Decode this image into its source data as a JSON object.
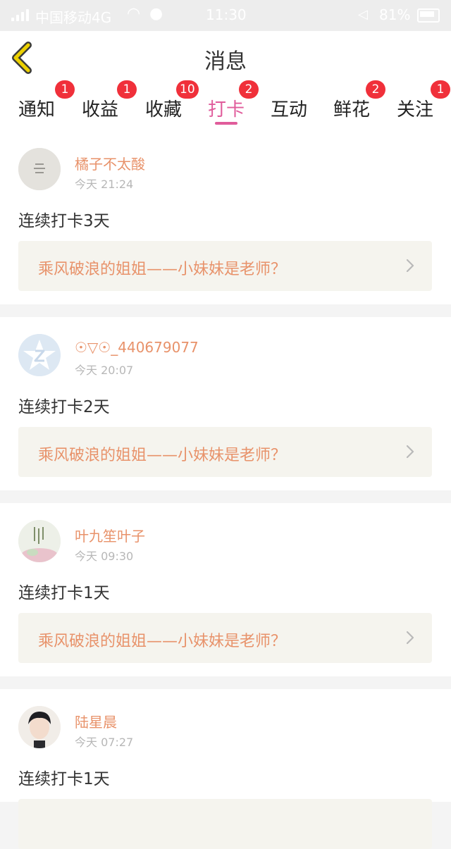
{
  "status_bar": {
    "carrier": "中国移动4G",
    "time": "11:30",
    "battery": "81%"
  },
  "header": {
    "title": "消息"
  },
  "tabs": [
    {
      "label": "通知",
      "badge": "1",
      "active": false
    },
    {
      "label": "收益",
      "badge": "1",
      "active": false
    },
    {
      "label": "收藏",
      "badge": "10",
      "active": false
    },
    {
      "label": "打卡",
      "badge": "2",
      "active": true
    },
    {
      "label": "互动",
      "badge": "",
      "active": false
    },
    {
      "label": "鲜花",
      "badge": "2",
      "active": false
    },
    {
      "label": "关注",
      "badge": "1",
      "active": false
    }
  ],
  "feed": [
    {
      "username": "橘子不太酸",
      "time": "今天 21:24",
      "message": "连续打卡3天",
      "topic": "乘风破浪的姐姐——小妹妹是老师？"
    },
    {
      "username": "☉▽☉_440679077",
      "time": "今天 20:07",
      "message": "连续打卡2天",
      "topic": "乘风破浪的姐姐——小妹妹是老师？"
    },
    {
      "username": "叶九笙叶子",
      "time": "今天 09:30",
      "message": "连续打卡1天",
      "topic": "乘风破浪的姐姐——小妹妹是老师？"
    },
    {
      "username": "陆星晨",
      "time": "今天 07:27",
      "message": "连续打卡1天",
      "topic": ""
    }
  ],
  "colors": {
    "accent_pink": "#e05c9b",
    "name_orange": "#e8926a",
    "badge_red": "#f0303a",
    "back_arrow": "#ecd000"
  }
}
